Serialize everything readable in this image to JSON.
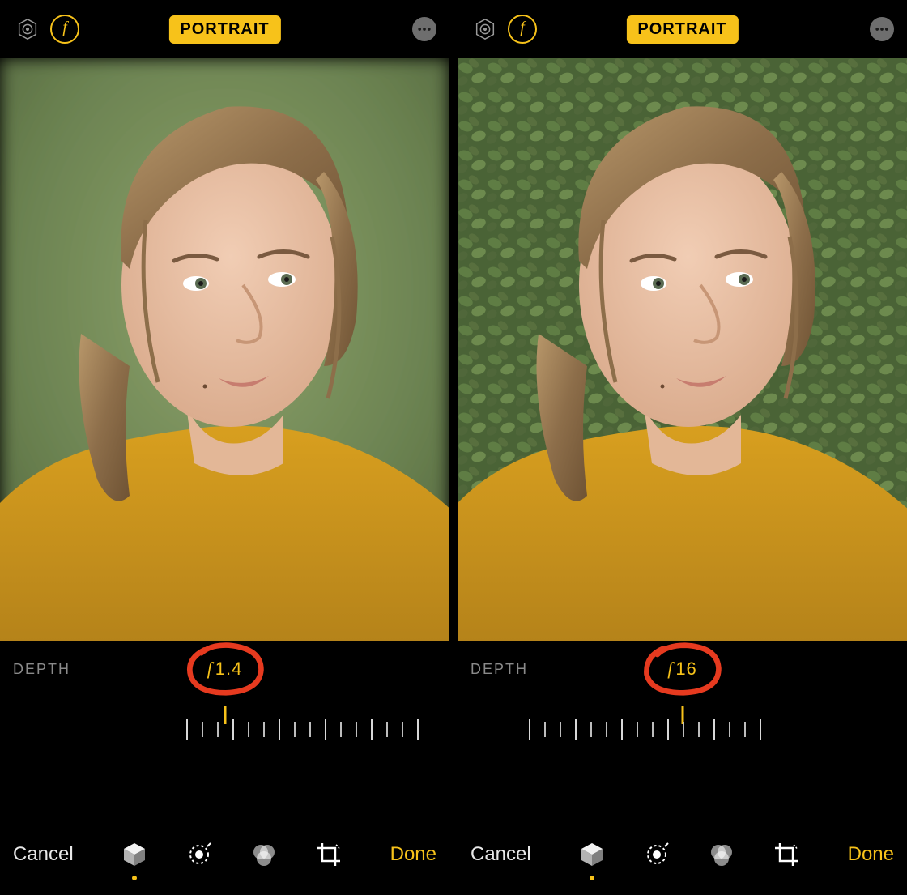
{
  "colors": {
    "accent": "#f7c21a",
    "annotation": "#e63a1f"
  },
  "screens": [
    {
      "topbar": {
        "icons_left": [
          "lighting-icon",
          "aperture-icon"
        ],
        "mode_pill": "PORTRAIT",
        "icon_right": "more-icon"
      },
      "depth": {
        "label": "DEPTH",
        "aperture": "1.4",
        "annotated": true
      },
      "slider": {
        "indicator_position": "center",
        "tick_shift": "right"
      },
      "bottombar": {
        "cancel": "Cancel",
        "done": "Done",
        "tools": [
          "portrait-cube",
          "adjust",
          "filters",
          "crop"
        ],
        "active_tool": "portrait-cube"
      }
    },
    {
      "topbar": {
        "icons_left": [
          "lighting-icon",
          "aperture-icon"
        ],
        "mode_pill": "PORTRAIT",
        "icon_right": "more-icon"
      },
      "depth": {
        "label": "DEPTH",
        "aperture": "16",
        "annotated": true
      },
      "slider": {
        "indicator_position": "center",
        "tick_shift": "left"
      },
      "bottombar": {
        "cancel": "Cancel",
        "done": "Done",
        "tools": [
          "portrait-cube",
          "adjust",
          "filters",
          "crop"
        ],
        "active_tool": "portrait-cube"
      }
    }
  ]
}
